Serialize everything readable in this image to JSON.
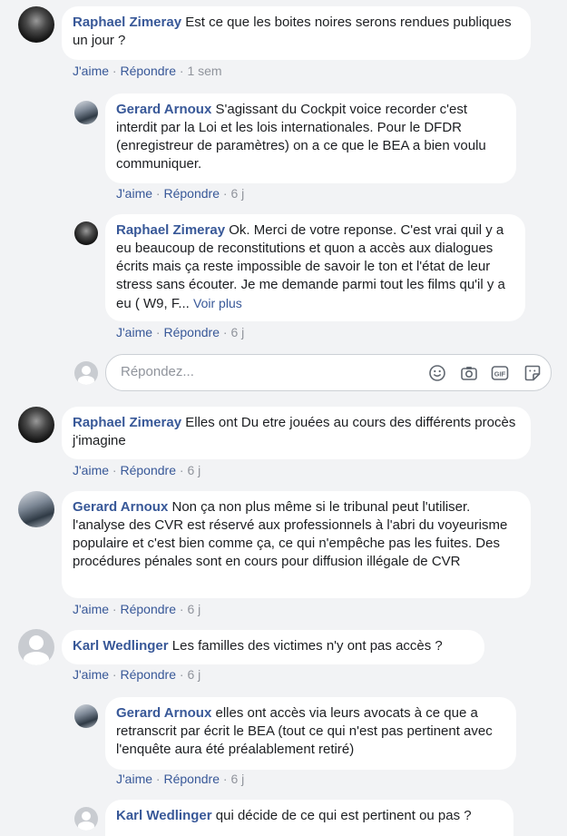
{
  "comments": [
    {
      "author": "Raphael Zimeray",
      "text": "Est ce que les boites noires serons rendues publiques un jour ?",
      "like": "J'aime",
      "reply": "Répondre",
      "time": "1 sem"
    },
    {
      "author": "Gerard Arnoux",
      "text": "S'agissant du Cockpit voice recorder c'est interdit par la Loi et les lois internationales. Pour le DFDR (enregistreur de paramètres) on a ce que le BEA a bien voulu communiquer.",
      "like": "J'aime",
      "reply": "Répondre",
      "time": "6 j"
    },
    {
      "author": "Raphael Zimeray",
      "text": "Ok. Merci de votre reponse. C'est vrai quil y a eu beaucoup de reconstitutions et quon a accès aux dialogues écrits mais ça reste impossible de savoir le ton et l'état de leur stress sans écouter. Je me demande parmi tout les films qu'il y a eu ( W9, F...",
      "see_more": "Voir plus",
      "like": "J'aime",
      "reply": "Répondre",
      "time": "6 j"
    },
    {
      "author": "Raphael Zimeray",
      "text": "Elles ont Du etre jouées au cours des différents procès j'imagine",
      "like": "J'aime",
      "reply": "Répondre",
      "time": "6 j"
    },
    {
      "author": "Gerard Arnoux",
      "text": "Non ça non plus même si le tribunal peut l'utiliser. l'analyse des CVR est réservé aux professionnels à l'abri du voyeurisme populaire et c'est bien comme ça, ce qui n'empêche pas les fuites. Des procédures pénales sont en cours pour diffusion illégale de CVR",
      "like": "J'aime",
      "reply": "Répondre",
      "time": "6 j"
    },
    {
      "author": "Karl Wedlinger",
      "text": "Les familles des victimes n'y ont pas accès ?",
      "like": "J'aime",
      "reply": "Répondre",
      "time": "6 j"
    },
    {
      "author": "Gerard Arnoux",
      "text": "elles ont accès via leurs avocats à ce que a retranscrit par écrit le BEA (tout ce qui n'est pas pertinent avec l'enquête aura été préalablement retiré)",
      "like": "J'aime",
      "reply": "Répondre",
      "time": "6 j"
    },
    {
      "author": "Karl Wedlinger",
      "text": "qui décide de ce qui est pertinent ou pas ?"
    }
  ],
  "reply_box": {
    "placeholder": "Répondez..."
  },
  "separator": "·",
  "icons": [
    "emoji-icon",
    "camera-icon",
    "gif-icon",
    "sticker-icon"
  ]
}
